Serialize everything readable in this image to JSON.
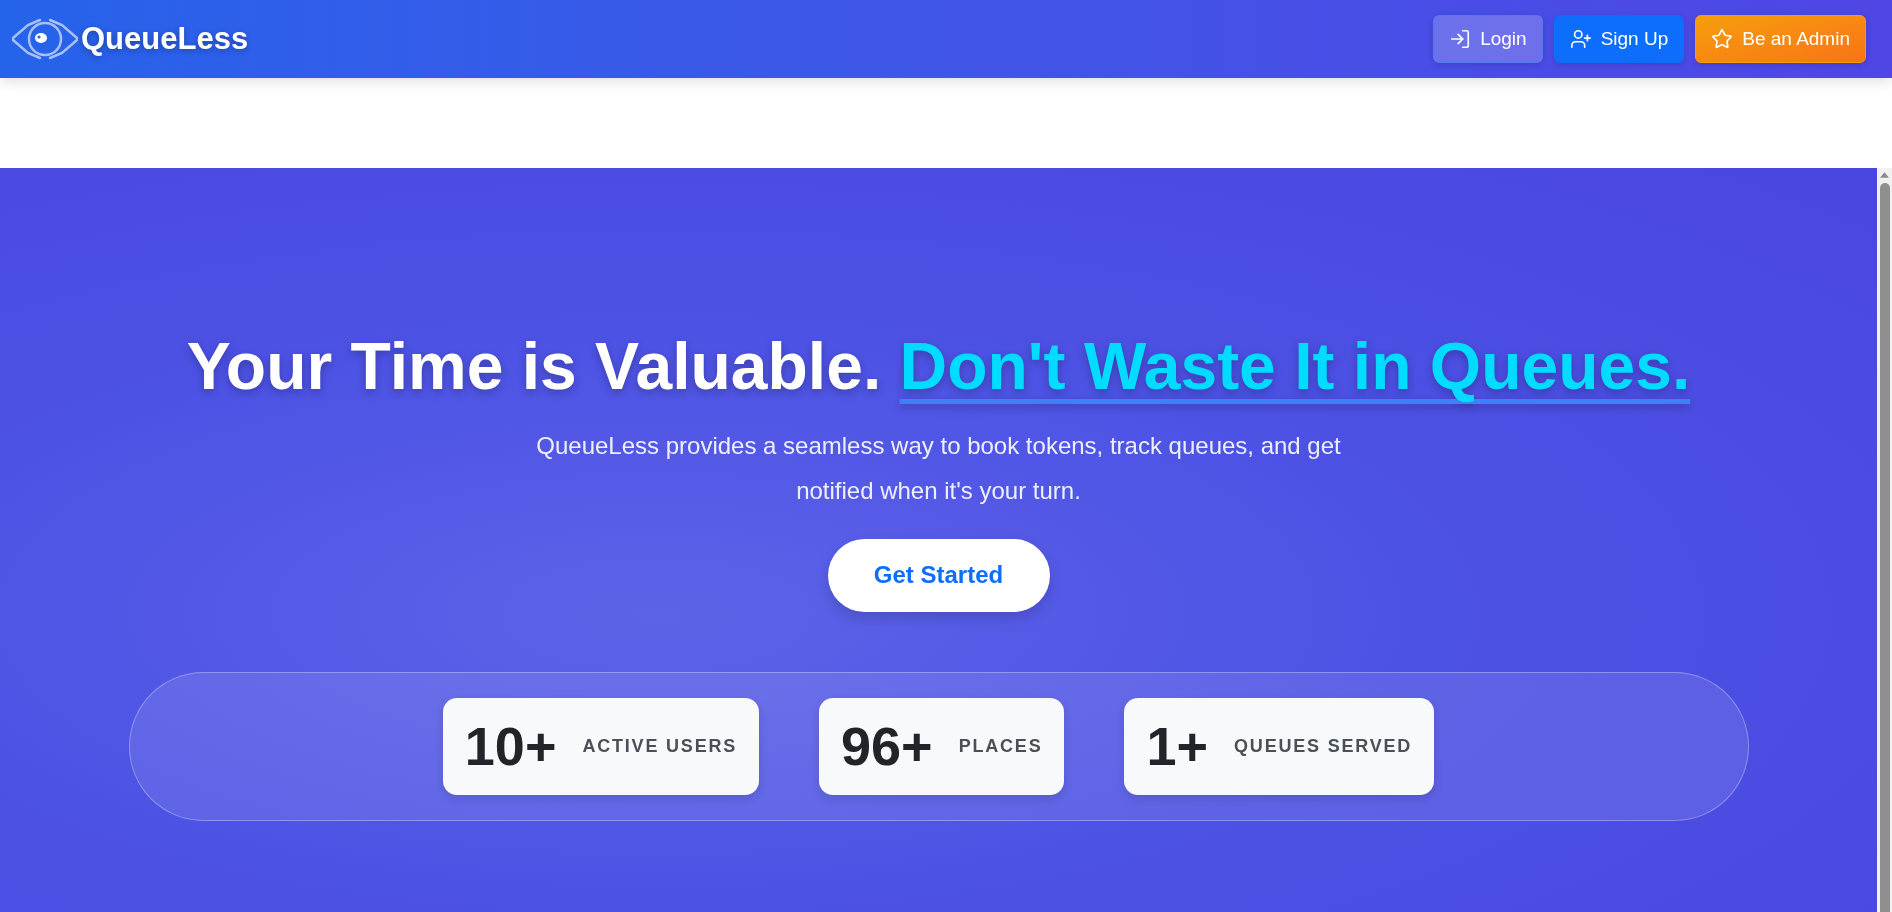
{
  "header": {
    "brand": "QueueLess",
    "buttons": [
      {
        "kind": "login",
        "label": "Login"
      },
      {
        "kind": "signup",
        "label": "Sign Up"
      },
      {
        "kind": "admin",
        "label": "Be an Admin"
      }
    ]
  },
  "hero": {
    "headline": "Your Time is Valuable.",
    "headline_highlight": "Don't Waste It in Queues.",
    "description": "QueueLess provides a seamless way to book tokens, track queues, and get notified when it's your turn.",
    "cta": "Get Started",
    "stats": [
      {
        "value": "10+",
        "label": "ACTIVE USERS"
      },
      {
        "value": "96+",
        "label": "PLACES"
      },
      {
        "value": "1+",
        "label": "QUEUES SERVED"
      }
    ]
  }
}
